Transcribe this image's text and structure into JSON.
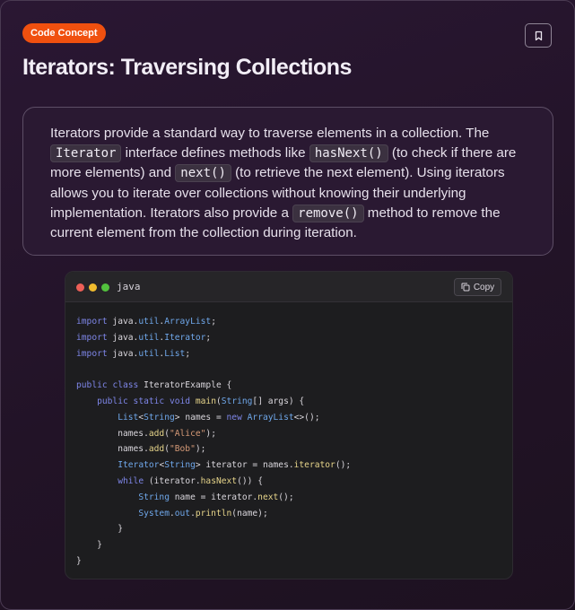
{
  "badge": "Code Concept",
  "title": "Iterators: Traversing Collections",
  "icons": {
    "bookmark": "bookmark-icon",
    "copy": "copy-icon"
  },
  "description": {
    "t1": "Iterators provide a standard way to traverse elements in a collection. The ",
    "c1": "Iterator",
    "t2": " interface defines methods like ",
    "c2": "hasNext()",
    "t3": " (to check if there are more elements) and ",
    "c3": "next()",
    "t4": " (to retrieve the next element). Using iterators allows you to iterate over collections without knowing their underlying implementation. Iterators also provide a ",
    "c4": "remove()",
    "t5": " method to remove the current element from the collection during iteration."
  },
  "code_block": {
    "language": "java",
    "copy_label": "Copy",
    "window_colors": [
      "#ed5f57",
      "#f0bc2e",
      "#52c13d"
    ],
    "lines": [
      "import java.util.ArrayList;",
      "import java.util.Iterator;",
      "import java.util.List;",
      "",
      "public class IteratorExample {",
      "    public static void main(String[] args) {",
      "        List<String> names = new ArrayList<>();",
      "        names.add(\"Alice\");",
      "        names.add(\"Bob\");",
      "        Iterator<String> iterator = names.iterator();",
      "        while (iterator.hasNext()) {",
      "            String name = iterator.next();",
      "            System.out.println(name);",
      "        }",
      "    }",
      "}"
    ]
  }
}
